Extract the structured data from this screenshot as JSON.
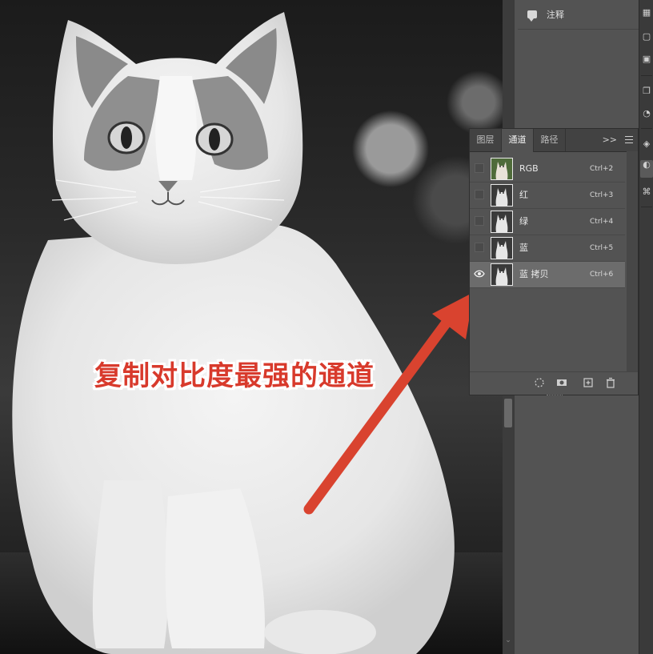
{
  "colors": {
    "annotation_text": "#d83a2c",
    "annotation_outline": "#ffffff",
    "arrow": "#d9432f",
    "panel_bg": "#535353",
    "selected_row": "#6c6c6c"
  },
  "annotation": {
    "text": "复制对比度最强的通道"
  },
  "top_panel": {
    "comments_label": "注释",
    "comments_icon": "comment-icon"
  },
  "channels_panel": {
    "tabs": [
      {
        "label": "图层",
        "active": false
      },
      {
        "label": "通道",
        "active": true
      },
      {
        "label": "路径",
        "active": false
      }
    ],
    "more": ">>",
    "menu_icon": "menu-icon",
    "channels": [
      {
        "name": "RGB",
        "shortcut": "Ctrl+2",
        "visible": false,
        "selected": false,
        "color": true
      },
      {
        "name": "红",
        "shortcut": "Ctrl+3",
        "visible": false,
        "selected": false,
        "color": false
      },
      {
        "name": "绿",
        "shortcut": "Ctrl+4",
        "visible": false,
        "selected": false,
        "color": false
      },
      {
        "name": "蓝",
        "shortcut": "Ctrl+5",
        "visible": false,
        "selected": false,
        "color": false
      },
      {
        "name": "蓝 拷贝",
        "shortcut": "Ctrl+6",
        "visible": true,
        "selected": true,
        "color": false
      }
    ],
    "footer_icons": [
      "load-selection-icon",
      "save-selection-as-channel-icon",
      "new-channel-icon",
      "delete-channel-icon"
    ]
  }
}
